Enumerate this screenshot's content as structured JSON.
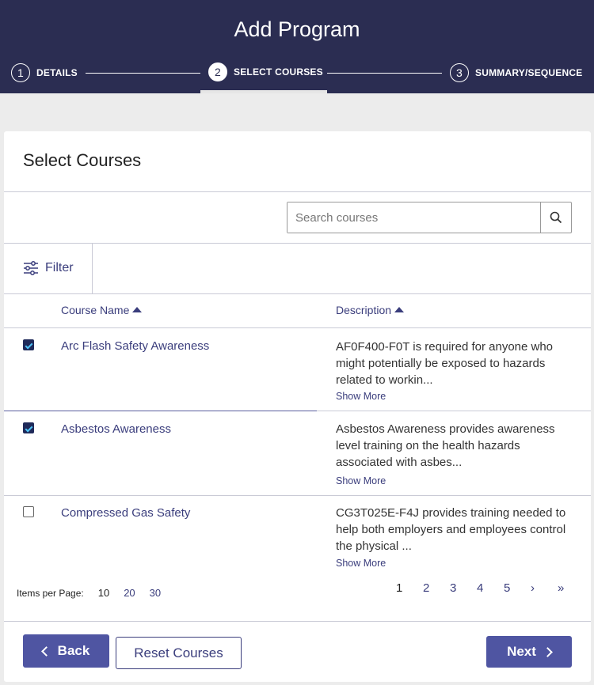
{
  "header": {
    "title": "Add Program",
    "steps": [
      {
        "num": "1",
        "label": "DETAILS"
      },
      {
        "num": "2",
        "label": "SELECT COURSES"
      },
      {
        "num": "3",
        "label": "SUMMARY/SEQUENCE"
      }
    ],
    "active_step": 2
  },
  "card": {
    "title": "Select Courses",
    "search": {
      "placeholder": "Search courses",
      "value": ""
    },
    "filter_label": "Filter",
    "columns": {
      "name": "Course Name",
      "description": "Description"
    },
    "rows": [
      {
        "checked": true,
        "name": "Arc Flash Safety Awareness",
        "description": "AF0F400-F0T is required for anyone who might potentially be exposed to hazards related to workin...",
        "show_more": "Show More"
      },
      {
        "checked": true,
        "name": "Asbestos Awareness",
        "description": "Asbestos Awareness provides awareness level training on the health hazards associated with asbes...",
        "show_more": "Show More"
      },
      {
        "checked": false,
        "name": "Compressed Gas Safety",
        "description": "CG3T025E-F4J provides training needed to help both employers and employees control the physical ...",
        "show_more": "Show More"
      }
    ],
    "items_per_page": {
      "label": "Items per Page:",
      "options": [
        "10",
        "20",
        "30"
      ],
      "selected": "10"
    },
    "pagination": {
      "pages": [
        "1",
        "2",
        "3",
        "4",
        "5"
      ],
      "current": "1",
      "next": "›",
      "last": "»"
    }
  },
  "footer": {
    "back_label": "Back",
    "reset_label": "Reset Courses",
    "next_label": "Next"
  },
  "colors": {
    "header_bg": "#2b2d52",
    "accent": "#4f55a2",
    "link": "#3a3d7c"
  }
}
